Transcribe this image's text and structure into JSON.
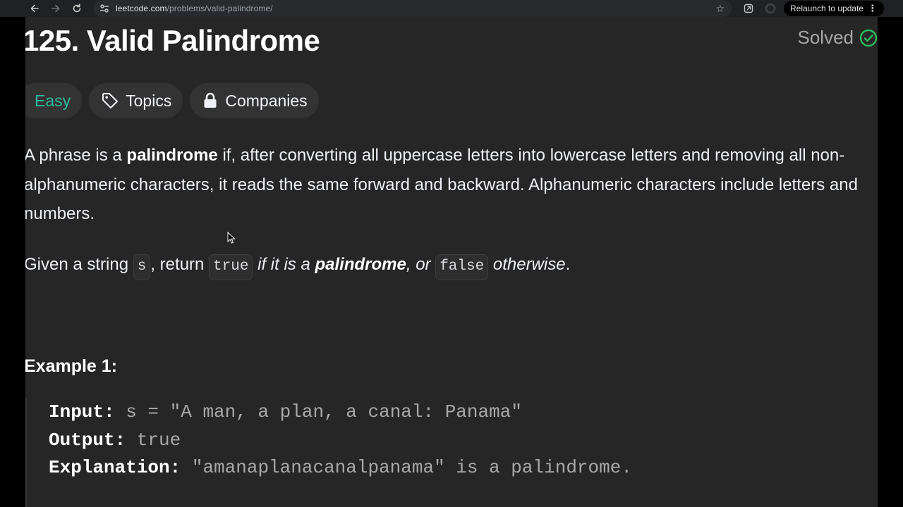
{
  "browser": {
    "url_host": "leetcode.com",
    "url_path": "/problems/valid-palindrome/",
    "relaunch_label": "Relaunch to update"
  },
  "problem": {
    "title": "125. Valid Palindrome",
    "status": "Solved",
    "difficulty": "Easy",
    "topics_label": "Topics",
    "companies_label": "Companies",
    "desc": {
      "p1_a": "A phrase is a ",
      "p1_b": "palindrome",
      "p1_c": " if, after converting all uppercase letters into lowercase letters and removing all non-alphanumeric characters, it reads the same forward and backward. Alphanumeric characters include letters and numbers."
    },
    "given": {
      "a": "Given a string ",
      "code_s": "s",
      "b": ", return ",
      "code_true": "true",
      "c": " if it is a ",
      "d": "palindrome",
      "e": ", or ",
      "code_false": "false",
      "f": " otherwise",
      "g": "."
    }
  },
  "example": {
    "heading": "Example 1:",
    "input_label": "Input:",
    "input_value": " s = \"A man, a plan, a canal: Panama\"",
    "output_label": "Output:",
    "output_value": " true",
    "explanation_label": "Explanation:",
    "explanation_value": " \"amanaplanacanalpanama\" is a palindrome."
  },
  "colors": {
    "easy": "#2cbb9c",
    "solved_check": "#2cbb5d",
    "page_bg": "#262626",
    "chip_bg": "#333333"
  },
  "icons": [
    "back-arrow-icon",
    "forward-arrow-icon",
    "reload-icon",
    "site-info-icon",
    "bookmark-star-icon",
    "extension-icon",
    "profile-icon",
    "menu-dots-icon",
    "tag-icon",
    "lock-icon",
    "check-circle-icon",
    "mouse-cursor-icon"
  ]
}
